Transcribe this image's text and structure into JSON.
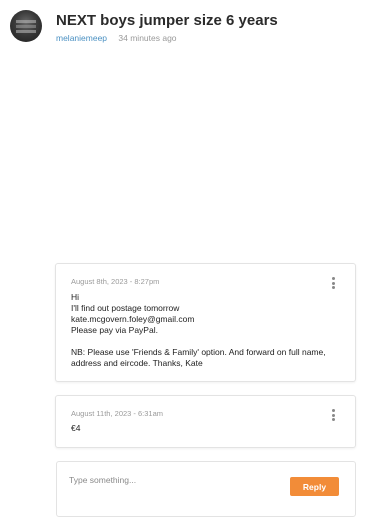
{
  "post": {
    "title": "NEXT boys jumper size 6 years",
    "author": "melaniemeep",
    "posted_ago": "34 minutes ago"
  },
  "messages": [
    {
      "date": "August 8th, 2023 - 8:27pm",
      "lines": [
        "Hi",
        "I'll find out postage tomorrow",
        "kate.mcgovern.foley@gmail.com",
        "Please pay via PayPal.",
        "",
        "NB: Please use 'Friends & Family' option. And forward on full name,",
        "address and eircode. Thanks, Kate"
      ]
    },
    {
      "date": "August 11th, 2023 - 6:31am",
      "lines": [
        "€4"
      ]
    }
  ],
  "reply": {
    "placeholder": "Type something...",
    "button_label": "Reply"
  },
  "colors": {
    "accent": "#f28c38",
    "link": "#4a90c2"
  }
}
